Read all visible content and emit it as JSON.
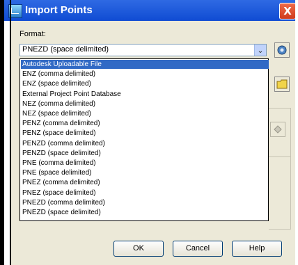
{
  "window": {
    "title": "Import Points",
    "close_glyph": "X"
  },
  "format": {
    "label": "Format:",
    "selected": "PNEZD (space delimited)",
    "options": [
      "Autodesk Uploadable File",
      "ENZ (comma delimited)",
      "ENZ (space delimited)",
      "External Project Point Database",
      "NEZ (comma delimited)",
      "NEZ (space delimited)",
      "PENZ (comma delimited)",
      "PENZ (space delimited)",
      "PENZD (comma delimited)",
      "PENZD (space delimited)",
      "PNE (comma delimited)",
      "PNE (space delimited)",
      "PNEZ (comma delimited)",
      "PNEZ (space delimited)",
      "PNEZD (comma delimited)",
      "PNEZD (space delimited)"
    ],
    "highlighted_option": "Autodesk Uploadable File"
  },
  "buttons": {
    "ok": "OK",
    "cancel": "Cancel",
    "help": "Help"
  },
  "icons": {
    "title": "import-points-icon",
    "format_manager": "format-manager-icon",
    "browse": "folder-icon",
    "add": "add-icon"
  }
}
